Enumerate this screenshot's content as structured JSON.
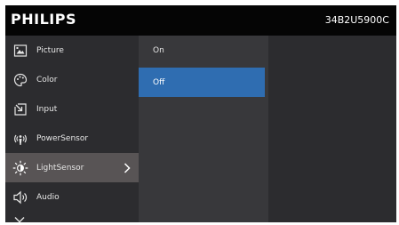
{
  "header": {
    "brand": "PHILIPS",
    "model": "34B2U5900C"
  },
  "menu": {
    "items": [
      {
        "label": "Picture",
        "icon": "picture-icon"
      },
      {
        "label": "Color",
        "icon": "palette-icon"
      },
      {
        "label": "Input",
        "icon": "input-icon"
      },
      {
        "label": "PowerSensor",
        "icon": "power-sensor-icon"
      },
      {
        "label": "LightSensor",
        "icon": "light-sensor-icon",
        "active": true
      },
      {
        "label": "Audio",
        "icon": "speaker-icon"
      }
    ]
  },
  "options": {
    "items": [
      {
        "label": "On"
      },
      {
        "label": "Off",
        "selected": true
      }
    ]
  },
  "colors": {
    "selected": "#2f6db1",
    "active_menu": "#585455",
    "panel": "#2c2c2f"
  }
}
